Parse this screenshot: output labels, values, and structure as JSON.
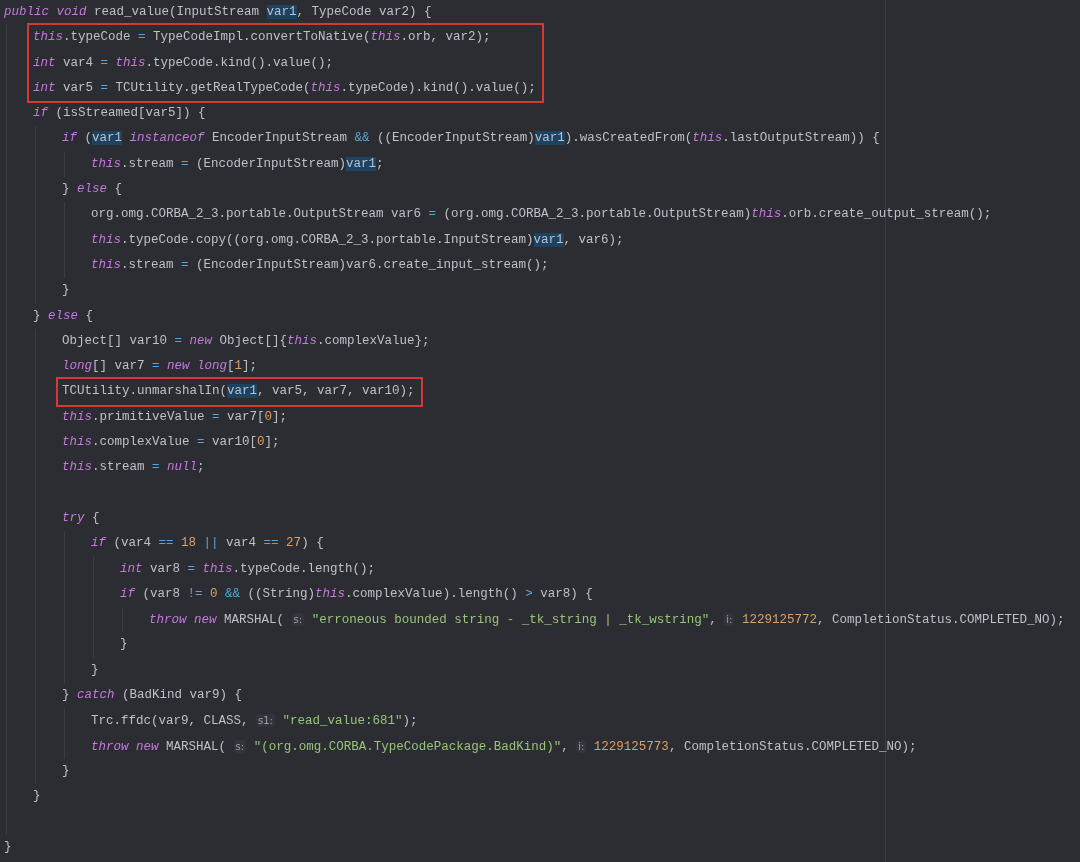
{
  "editor": {
    "lines": [
      {
        "kind": "line",
        "tokens": [
          {
            "kind": "kw",
            "text": "public void"
          },
          {
            "kind": "text",
            "text": " read_value(InputStream "
          },
          {
            "kind": "ref",
            "text": "var1"
          },
          {
            "kind": "text",
            "text": ", TypeCode var2) {"
          }
        ],
        "children": [
          {
            "kind": "highlight",
            "lines": [
              {
                "kind": "line",
                "tokens": [
                  {
                    "kind": "kw",
                    "text": "this"
                  },
                  {
                    "kind": "text",
                    "text": ".typeCode "
                  },
                  {
                    "kind": "op",
                    "text": "="
                  },
                  {
                    "kind": "text",
                    "text": " TypeCodeImpl.convertToNative("
                  },
                  {
                    "kind": "kw",
                    "text": "this"
                  },
                  {
                    "kind": "text",
                    "text": ".orb, var2);"
                  }
                ]
              },
              {
                "kind": "line",
                "tokens": [
                  {
                    "kind": "kw",
                    "text": "int"
                  },
                  {
                    "kind": "text",
                    "text": " var4 "
                  },
                  {
                    "kind": "op",
                    "text": "="
                  },
                  {
                    "kind": "kw",
                    "text": " this"
                  },
                  {
                    "kind": "text",
                    "text": ".typeCode.kind().value();"
                  }
                ]
              },
              {
                "kind": "line",
                "tokens": [
                  {
                    "kind": "kw",
                    "text": "int"
                  },
                  {
                    "kind": "text",
                    "text": " var5 "
                  },
                  {
                    "kind": "op",
                    "text": "="
                  },
                  {
                    "kind": "text",
                    "text": " TCUtility.getRealTypeCode("
                  },
                  {
                    "kind": "kw",
                    "text": "this"
                  },
                  {
                    "kind": "text",
                    "text": ".typeCode).kind().value();"
                  }
                ]
              }
            ]
          },
          {
            "kind": "line",
            "tokens": [
              {
                "kind": "kw",
                "text": "if"
              },
              {
                "kind": "text",
                "text": " (isStreamed[var5]) {"
              }
            ],
            "children": [
              {
                "kind": "line",
                "tokens": [
                  {
                    "kind": "kw",
                    "text": "if"
                  },
                  {
                    "kind": "text",
                    "text": " ("
                  },
                  {
                    "kind": "ref",
                    "text": "var1"
                  },
                  {
                    "kind": "kw",
                    "text": " instanceof"
                  },
                  {
                    "kind": "text",
                    "text": " EncoderInputStream "
                  },
                  {
                    "kind": "op",
                    "text": "&&"
                  },
                  {
                    "kind": "text",
                    "text": " ((EncoderInputStream)"
                  },
                  {
                    "kind": "ref",
                    "text": "var1"
                  },
                  {
                    "kind": "text",
                    "text": ").wasCreatedFrom("
                  },
                  {
                    "kind": "kw",
                    "text": "this"
                  },
                  {
                    "kind": "text",
                    "text": ".lastOutputStream)) {"
                  }
                ],
                "children": [
                  {
                    "kind": "line",
                    "tokens": [
                      {
                        "kind": "kw",
                        "text": "this"
                      },
                      {
                        "kind": "text",
                        "text": ".stream "
                      },
                      {
                        "kind": "op",
                        "text": "="
                      },
                      {
                        "kind": "text",
                        "text": " (EncoderInputStream)"
                      },
                      {
                        "kind": "ref",
                        "text": "var1"
                      },
                      {
                        "kind": "text",
                        "text": ";"
                      }
                    ]
                  }
                ]
              },
              {
                "kind": "line",
                "tokens": [
                  {
                    "kind": "text",
                    "text": "} "
                  },
                  {
                    "kind": "kw",
                    "text": "else"
                  },
                  {
                    "kind": "text",
                    "text": " {"
                  }
                ],
                "children": [
                  {
                    "kind": "line",
                    "tokens": [
                      {
                        "kind": "text",
                        "text": "org.omg.CORBA_2_3.portable.OutputStream var6 "
                      },
                      {
                        "kind": "op",
                        "text": "="
                      },
                      {
                        "kind": "text",
                        "text": " (org.omg.CORBA_2_3.portable.OutputStream)"
                      },
                      {
                        "kind": "kw",
                        "text": "this"
                      },
                      {
                        "kind": "text",
                        "text": ".orb.create_output_stream();"
                      }
                    ]
                  },
                  {
                    "kind": "line",
                    "tokens": [
                      {
                        "kind": "kw",
                        "text": "this"
                      },
                      {
                        "kind": "text",
                        "text": ".typeCode.copy((org.omg.CORBA_2_3.portable.InputStream)"
                      },
                      {
                        "kind": "ref",
                        "text": "var1"
                      },
                      {
                        "kind": "text",
                        "text": ", var6);"
                      }
                    ]
                  },
                  {
                    "kind": "line",
                    "tokens": [
                      {
                        "kind": "kw",
                        "text": "this"
                      },
                      {
                        "kind": "text",
                        "text": ".stream "
                      },
                      {
                        "kind": "op",
                        "text": "="
                      },
                      {
                        "kind": "text",
                        "text": " (EncoderInputStream)var6.create_input_stream();"
                      }
                    ]
                  }
                ]
              },
              {
                "kind": "line",
                "tokens": [
                  {
                    "kind": "text",
                    "text": "}"
                  }
                ]
              }
            ]
          },
          {
            "kind": "line",
            "tokens": [
              {
                "kind": "text",
                "text": "} "
              },
              {
                "kind": "kw",
                "text": "else"
              },
              {
                "kind": "text",
                "text": " {"
              }
            ],
            "children": [
              {
                "kind": "line",
                "tokens": [
                  {
                    "kind": "text",
                    "text": "Object[] var10 "
                  },
                  {
                    "kind": "op",
                    "text": "="
                  },
                  {
                    "kind": "kw",
                    "text": " new"
                  },
                  {
                    "kind": "text",
                    "text": " Object[]{"
                  },
                  {
                    "kind": "kw",
                    "text": "this"
                  },
                  {
                    "kind": "text",
                    "text": ".complexValue};"
                  }
                ]
              },
              {
                "kind": "line",
                "tokens": [
                  {
                    "kind": "kw",
                    "text": "long"
                  },
                  {
                    "kind": "text",
                    "text": "[] var7 "
                  },
                  {
                    "kind": "op",
                    "text": "="
                  },
                  {
                    "kind": "kw",
                    "text": " new long"
                  },
                  {
                    "kind": "text",
                    "text": "["
                  },
                  {
                    "kind": "num",
                    "text": "1"
                  },
                  {
                    "kind": "text",
                    "text": "];"
                  }
                ]
              },
              {
                "kind": "highlight",
                "lines": [
                  {
                    "kind": "line",
                    "tokens": [
                      {
                        "kind": "text",
                        "text": "TCUtility.unmarshalIn("
                      },
                      {
                        "kind": "ref",
                        "text": "var1"
                      },
                      {
                        "kind": "text",
                        "text": ", var5, var7, var10);"
                      }
                    ]
                  }
                ]
              },
              {
                "kind": "line",
                "tokens": [
                  {
                    "kind": "kw",
                    "text": "this"
                  },
                  {
                    "kind": "text",
                    "text": ".primitiveValue "
                  },
                  {
                    "kind": "op",
                    "text": "="
                  },
                  {
                    "kind": "text",
                    "text": " var7["
                  },
                  {
                    "kind": "num",
                    "text": "0"
                  },
                  {
                    "kind": "text",
                    "text": "];"
                  }
                ]
              },
              {
                "kind": "line",
                "tokens": [
                  {
                    "kind": "kw",
                    "text": "this"
                  },
                  {
                    "kind": "text",
                    "text": ".complexValue "
                  },
                  {
                    "kind": "op",
                    "text": "="
                  },
                  {
                    "kind": "text",
                    "text": " var10["
                  },
                  {
                    "kind": "num",
                    "text": "0"
                  },
                  {
                    "kind": "text",
                    "text": "];"
                  }
                ]
              },
              {
                "kind": "line",
                "tokens": [
                  {
                    "kind": "kw",
                    "text": "this"
                  },
                  {
                    "kind": "text",
                    "text": ".stream "
                  },
                  {
                    "kind": "op",
                    "text": "="
                  },
                  {
                    "kind": "kw",
                    "text": " null"
                  },
                  {
                    "kind": "text",
                    "text": ";"
                  }
                ]
              },
              {
                "kind": "blank"
              },
              {
                "kind": "line",
                "tokens": [
                  {
                    "kind": "kw",
                    "text": "try"
                  },
                  {
                    "kind": "text",
                    "text": " {"
                  }
                ],
                "children": [
                  {
                    "kind": "line",
                    "tokens": [
                      {
                        "kind": "kw",
                        "text": "if"
                      },
                      {
                        "kind": "text",
                        "text": " (var4 "
                      },
                      {
                        "kind": "op",
                        "text": "=="
                      },
                      {
                        "kind": "num",
                        "text": " 18"
                      },
                      {
                        "kind": "op",
                        "text": " ||"
                      },
                      {
                        "kind": "text",
                        "text": " var4 "
                      },
                      {
                        "kind": "op",
                        "text": "=="
                      },
                      {
                        "kind": "num",
                        "text": " 27"
                      },
                      {
                        "kind": "text",
                        "text": ") {"
                      }
                    ],
                    "children": [
                      {
                        "kind": "line",
                        "tokens": [
                          {
                            "kind": "kw",
                            "text": "int"
                          },
                          {
                            "kind": "text",
                            "text": " var8 "
                          },
                          {
                            "kind": "op",
                            "text": "="
                          },
                          {
                            "kind": "kw",
                            "text": " this"
                          },
                          {
                            "kind": "text",
                            "text": ".typeCode.length();"
                          }
                        ]
                      },
                      {
                        "kind": "line",
                        "tokens": [
                          {
                            "kind": "kw",
                            "text": "if"
                          },
                          {
                            "kind": "text",
                            "text": " (var8 "
                          },
                          {
                            "kind": "op",
                            "text": "!="
                          },
                          {
                            "kind": "num",
                            "text": " 0"
                          },
                          {
                            "kind": "op",
                            "text": " &&"
                          },
                          {
                            "kind": "text",
                            "text": " ((String)"
                          },
                          {
                            "kind": "kw",
                            "text": "this"
                          },
                          {
                            "kind": "text",
                            "text": ".complexValue).length() "
                          },
                          {
                            "kind": "op",
                            "text": ">"
                          },
                          {
                            "kind": "text",
                            "text": " var8) {"
                          }
                        ],
                        "children": [
                          {
                            "kind": "line",
                            "tokens": [
                              {
                                "kind": "kw",
                                "text": "throw new"
                              },
                              {
                                "kind": "text",
                                "text": " MARSHAL( "
                              },
                              {
                                "kind": "hint",
                                "text": "s:"
                              },
                              {
                                "kind": "str",
                                "text": " \"erroneous bounded string - _tk_string | _tk_wstring\""
                              },
                              {
                                "kind": "text",
                                "text": ", "
                              },
                              {
                                "kind": "hint",
                                "text": "i:"
                              },
                              {
                                "kind": "num",
                                "text": " 1229125772"
                              },
                              {
                                "kind": "text",
                                "text": ", CompletionStatus.COMPLETED_NO);"
                              }
                            ]
                          }
                        ]
                      },
                      {
                        "kind": "line",
                        "tokens": [
                          {
                            "kind": "text",
                            "text": "}"
                          }
                        ]
                      }
                    ]
                  },
                  {
                    "kind": "line",
                    "tokens": [
                      {
                        "kind": "text",
                        "text": "}"
                      }
                    ]
                  }
                ]
              },
              {
                "kind": "line",
                "tokens": [
                  {
                    "kind": "text",
                    "text": "} "
                  },
                  {
                    "kind": "kw",
                    "text": "catch"
                  },
                  {
                    "kind": "text",
                    "text": " (BadKind var9) {"
                  }
                ],
                "children": [
                  {
                    "kind": "line",
                    "tokens": [
                      {
                        "kind": "text",
                        "text": "Trc.ffdc(var9, CLASS, "
                      },
                      {
                        "kind": "hint",
                        "text": "s1:"
                      },
                      {
                        "kind": "str",
                        "text": " \"read_value:681\""
                      },
                      {
                        "kind": "text",
                        "text": ");"
                      }
                    ]
                  },
                  {
                    "kind": "line",
                    "tokens": [
                      {
                        "kind": "kw",
                        "text": "throw new"
                      },
                      {
                        "kind": "text",
                        "text": " MARSHAL( "
                      },
                      {
                        "kind": "hint",
                        "text": "s:"
                      },
                      {
                        "kind": "str",
                        "text": " \"(org.omg.CORBA.TypeCodePackage.BadKind)\""
                      },
                      {
                        "kind": "text",
                        "text": ", "
                      },
                      {
                        "kind": "hint",
                        "text": "i:"
                      },
                      {
                        "kind": "num",
                        "text": " 1229125773"
                      },
                      {
                        "kind": "text",
                        "text": ", CompletionStatus.COMPLETED_NO);"
                      }
                    ]
                  }
                ]
              },
              {
                "kind": "line",
                "tokens": [
                  {
                    "kind": "text",
                    "text": "}"
                  }
                ]
              }
            ]
          },
          {
            "kind": "line",
            "tokens": [
              {
                "kind": "text",
                "text": "}"
              }
            ]
          },
          {
            "kind": "blank"
          }
        ]
      },
      {
        "kind": "line",
        "tokens": [
          {
            "kind": "text",
            "text": "}"
          }
        ]
      }
    ]
  }
}
